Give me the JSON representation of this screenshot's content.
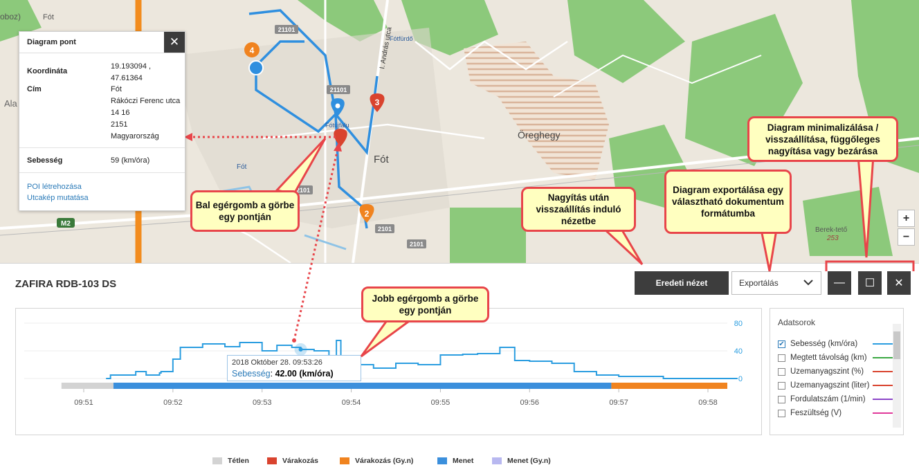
{
  "map": {
    "labels": {
      "top_left": "oboz)",
      "fot_top": "Fót",
      "fot": "Fót",
      "fot_small": "Fót",
      "fotfurdo": "Fótfürdő",
      "fotujfalu": "Fótújfalu",
      "oreghegy": "Öreghegy",
      "berek": "Berek-tető",
      "berek_alt": "253",
      "ala": "Ala",
      "andras": "I. András utca",
      "road_2101": "2101",
      "road_21101": "21101",
      "m2": "M2"
    },
    "markers": [
      "4",
      "3",
      "2"
    ],
    "zoom_in": "+",
    "zoom_out": "−"
  },
  "popup": {
    "title": "Diagram pont",
    "close": "✕",
    "coord_label": "Koordináta",
    "coord_value": [
      "19.193094 ,",
      "47.61364"
    ],
    "addr_label": "Cím",
    "addr_value": [
      "Fót",
      "Rákóczi Ferenc utca",
      "14 16",
      "2151",
      "Magyarország"
    ],
    "speed_label": "Sebesség",
    "speed_value": "59 (km/óra)",
    "poi_link": "POI létrehozása",
    "street_link": "Utcakép mutatása"
  },
  "vehicle_title": "ZAFIRA RDB-103 DS",
  "toolbar": {
    "reset_label": "Eredeti nézet",
    "export_label": "Exportálás",
    "minimize": "—",
    "maximize": "☐",
    "close": "✕"
  },
  "tooltip": {
    "time": "2018 Október 28. 09:53:26",
    "label": "Sebesség",
    "value": "42.00 (km/óra)"
  },
  "legend": [
    {
      "label": "Tétlen",
      "color": "#d3d3d3"
    },
    {
      "label": "Várakozás",
      "color": "#d9432e"
    },
    {
      "label": "Várakozás (Gy.n)",
      "color": "#f0831f"
    },
    {
      "label": "Menet",
      "color": "#3b8fdc"
    },
    {
      "label": "Menet (Gy.n)",
      "color": "#b8b8f0"
    }
  ],
  "series_panel": {
    "title": "Adatsorok",
    "items": [
      {
        "label": "Sebesség (km/óra)",
        "checked": true,
        "color": "#2a9de0"
      },
      {
        "label": "Megtett távolság (km)",
        "checked": false,
        "color": "#3aa842"
      },
      {
        "label": "Üzemanyagszint (%)",
        "checked": false,
        "color": "#d9432e"
      },
      {
        "label": "Üzemanyagszint (liter)",
        "checked": false,
        "color": "#d9432e"
      },
      {
        "label": "Fordulatszám (1/min)",
        "checked": false,
        "color": "#8b44c8"
      },
      {
        "label": "Feszültség (V)",
        "checked": false,
        "color": "#e0399a"
      }
    ]
  },
  "callouts": {
    "left_click": "Bal egérgomb a görbe egy pontján",
    "right_click": "Jobb egérgomb a görbe egy pontján",
    "reset": "Nagyítás után visszaállítás induló nézetbe",
    "export": "Diagram exportálása egy választható dokumentum formátumba",
    "window": "Diagram minimalizálása / visszaállítása, függőleges nagyítása vagy bezárása"
  },
  "chart_data": {
    "type": "line",
    "xlabel": "",
    "ylabel": "",
    "x_ticks": [
      "09:51",
      "09:52",
      "09:53",
      "09:54",
      "09:55",
      "09:56",
      "09:57",
      "09:58"
    ],
    "y_ticks": [
      0,
      40,
      80
    ],
    "ylim": [
      0,
      80
    ],
    "series": [
      {
        "name": "Sebesség (km/óra)",
        "x": [
          "09:51:15",
          "09:51:18",
          "09:51:35",
          "09:51:42",
          "09:51:51",
          "09:51:52",
          "09:52:00",
          "09:52:05",
          "09:52:20",
          "09:52:35",
          "09:52:45",
          "09:53:00",
          "09:53:10",
          "09:53:20",
          "09:53:26",
          "09:53:35",
          "09:53:45",
          "09:53:50",
          "09:53:53",
          "09:54:05",
          "09:54:15",
          "09:54:30",
          "09:54:45",
          "09:55:00",
          "09:55:15",
          "09:55:25",
          "09:55:40",
          "09:55:50",
          "09:56:00",
          "09:56:15",
          "09:56:30",
          "09:56:45",
          "09:57:00",
          "09:57:30",
          "09:58:20"
        ],
        "values": [
          0,
          5,
          10,
          5,
          8,
          10,
          28,
          45,
          50,
          46,
          52,
          40,
          48,
          45,
          42,
          40,
          22,
          55,
          8,
          20,
          15,
          22,
          20,
          34,
          35,
          36,
          45,
          26,
          25,
          22,
          10,
          5,
          3,
          0,
          0
        ]
      }
    ],
    "state_bar": [
      {
        "state": "Tétlen",
        "from": "09:50:45",
        "to": "09:51:20"
      },
      {
        "state": "Menet",
        "from": "09:51:20",
        "to": "09:56:55"
      },
      {
        "state": "Várakozás (Gy.n)",
        "from": "09:56:55",
        "to": "09:58:25"
      }
    ]
  }
}
